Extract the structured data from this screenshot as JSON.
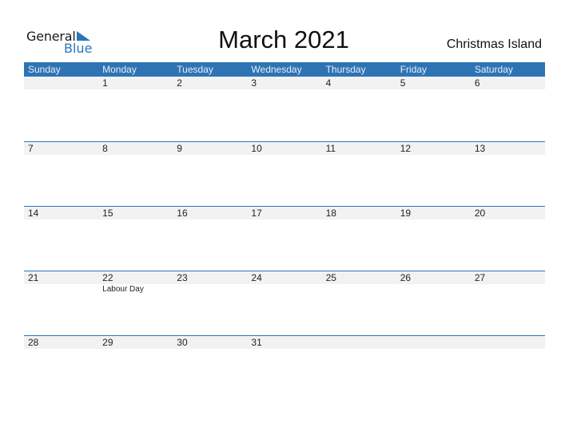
{
  "logo": {
    "general": "General",
    "blue": "Blue",
    "brand_color": "#2a76b8"
  },
  "title": "March 2021",
  "country": "Christmas Island",
  "header_color": "#2e74b5",
  "weekdays": [
    "Sunday",
    "Monday",
    "Tuesday",
    "Wednesday",
    "Thursday",
    "Friday",
    "Saturday"
  ],
  "weeks": [
    {
      "days": [
        "",
        "1",
        "2",
        "3",
        "4",
        "5",
        "6"
      ],
      "events": [
        "",
        "",
        "",
        "",
        "",
        "",
        ""
      ]
    },
    {
      "days": [
        "7",
        "8",
        "9",
        "10",
        "11",
        "12",
        "13"
      ],
      "events": [
        "",
        "",
        "",
        "",
        "",
        "",
        ""
      ]
    },
    {
      "days": [
        "14",
        "15",
        "16",
        "17",
        "18",
        "19",
        "20"
      ],
      "events": [
        "",
        "",
        "",
        "",
        "",
        "",
        ""
      ]
    },
    {
      "days": [
        "21",
        "22",
        "23",
        "24",
        "25",
        "26",
        "27"
      ],
      "events": [
        "",
        "Labour Day",
        "",
        "",
        "",
        "",
        ""
      ]
    },
    {
      "days": [
        "28",
        "29",
        "30",
        "31",
        "",
        "",
        ""
      ],
      "events": [
        "",
        "",
        "",
        "",
        "",
        "",
        ""
      ]
    }
  ]
}
